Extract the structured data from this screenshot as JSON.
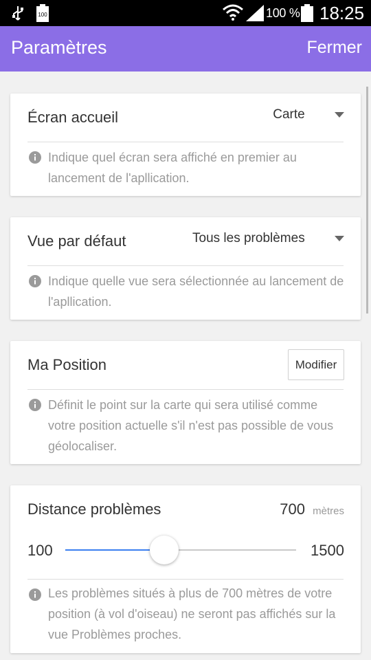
{
  "status_bar": {
    "battery_small_label": "100",
    "battery_percent": "100 %",
    "time": "18:25"
  },
  "app_bar": {
    "title": "Paramètres",
    "close_label": "Fermer"
  },
  "settings": {
    "home_screen": {
      "label": "Écran accueil",
      "value": "Carte",
      "info": "Indique quel écran sera affiché en premier au lancement de l'apllication."
    },
    "default_view": {
      "label": "Vue par défaut",
      "value": "Tous les problèmes",
      "info": "Indique quelle vue sera sélectionnée au lancement de l'apllication."
    },
    "my_position": {
      "label": "Ma Position",
      "button_label": "Modifier",
      "info": "Définit le point sur la carte qui sera utilisé comme votre position actuelle s'il n'est pas possible de vous géolocaliser."
    },
    "distance": {
      "label": "Distance problèmes",
      "value": "700",
      "unit": "mètres",
      "min_label": "100",
      "max_label": "1500",
      "min": 100,
      "max": 1500,
      "current": 700,
      "info": "Les problèmes situés à plus de 700 mètres de votre position (à vol d'oiseau) ne seront pas affichés sur la vue Problèmes proches."
    }
  },
  "colors": {
    "app_bar": "#8b6ee6",
    "slider_fill": "#3a7ef0"
  }
}
